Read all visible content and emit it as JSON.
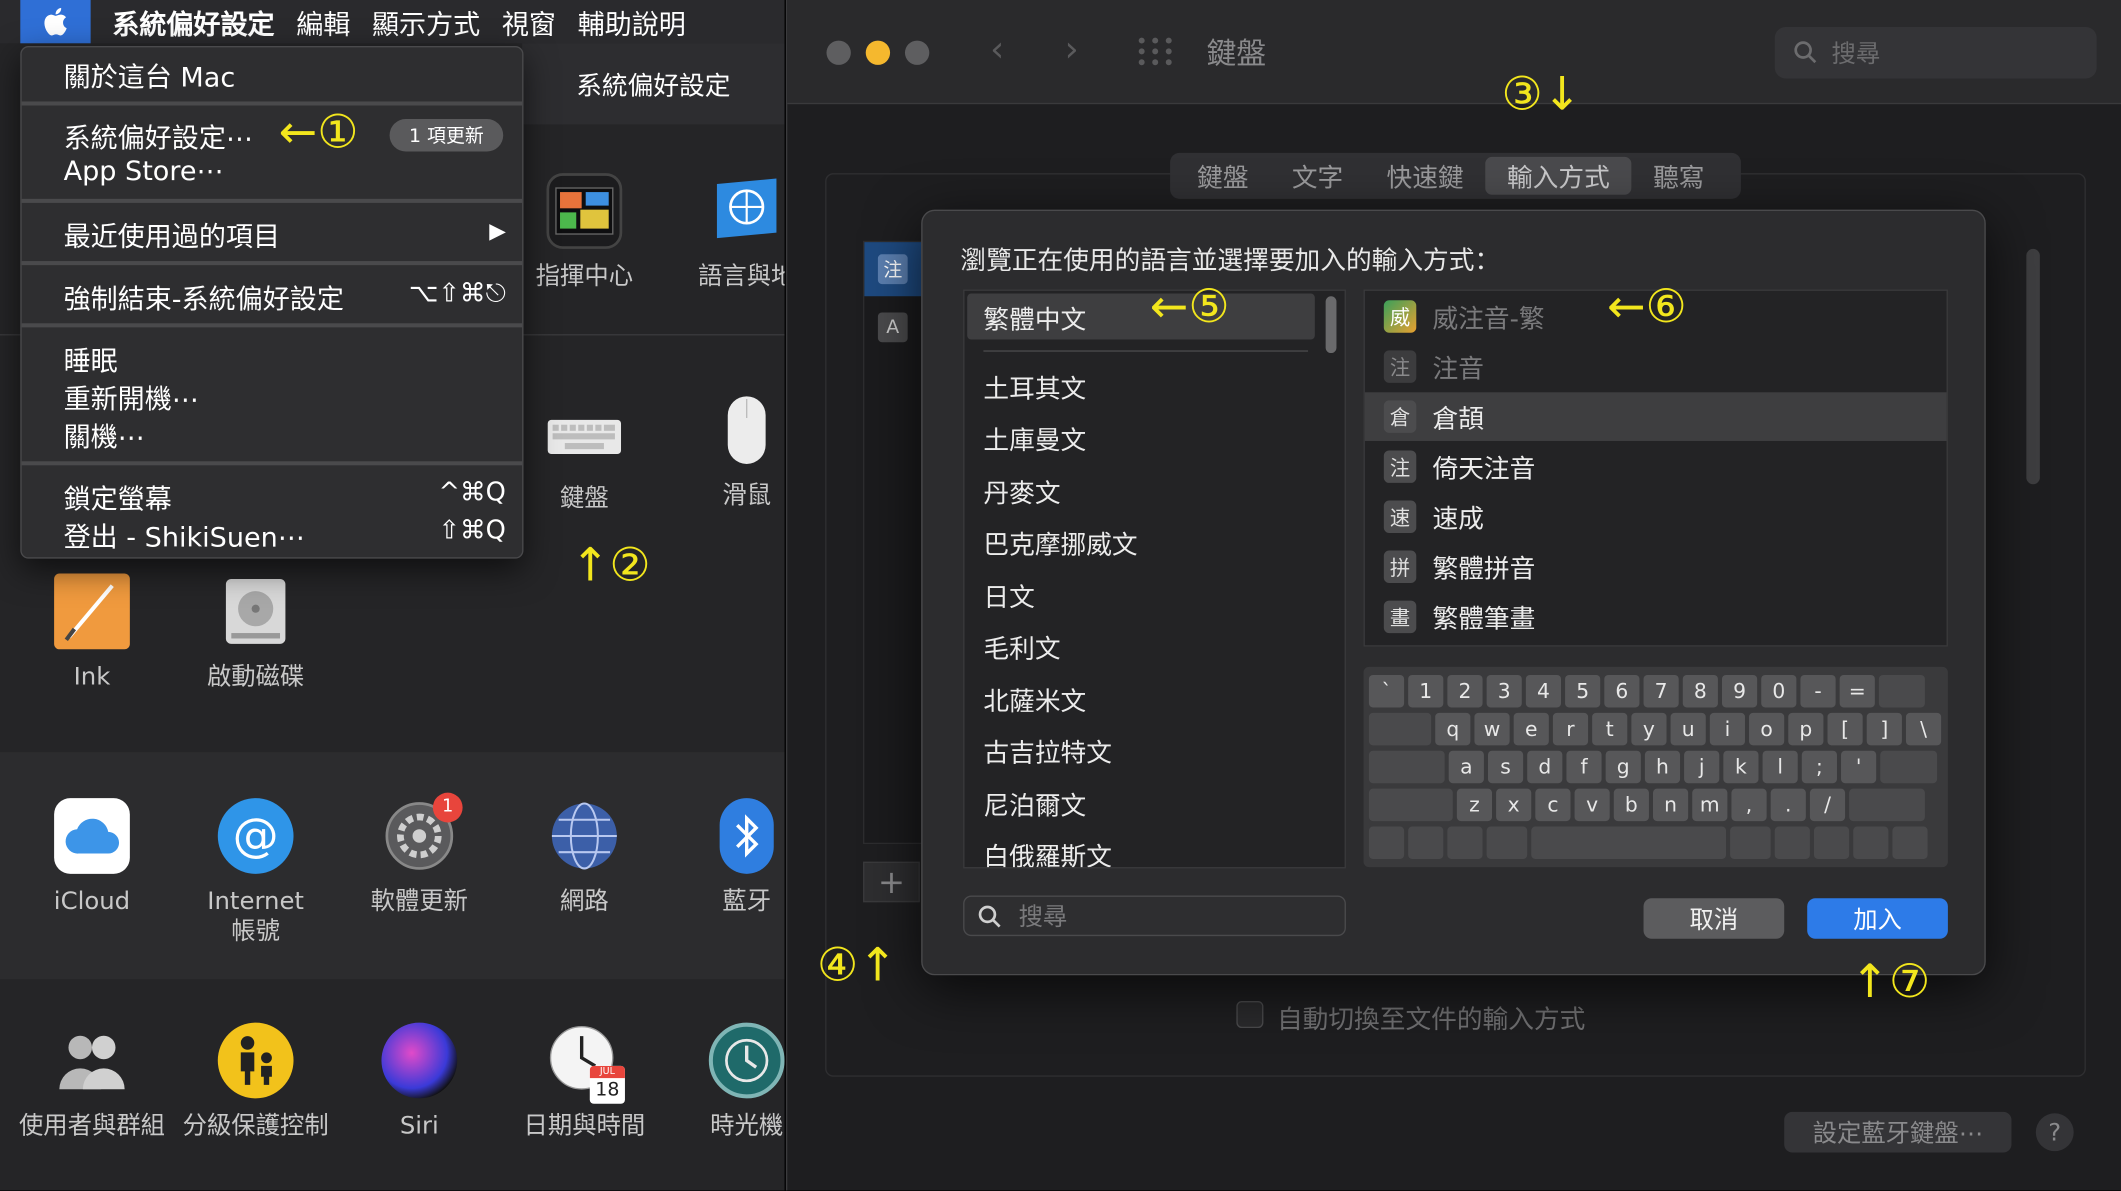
{
  "menubar": {
    "apple": "",
    "items": [
      "系統偏好設定",
      "編輯",
      "顯示方式",
      "視窗",
      "輔助說明"
    ]
  },
  "left_window": {
    "title": "系統偏好設定",
    "row1": [
      {
        "label": "指揮中心",
        "icon": "mission-control-icon"
      },
      {
        "label": "語言與地",
        "icon": "globe-flag-icon"
      }
    ],
    "row2": [
      {
        "label": "鍵盤",
        "icon": "keyboard-icon"
      },
      {
        "label": "滑鼠",
        "icon": "mouse-icon"
      }
    ],
    "row3": [
      {
        "label": "Ink",
        "icon": "ink-icon"
      },
      {
        "label": "啟動磁碟",
        "icon": "disk-icon"
      }
    ],
    "row4": [
      {
        "label": "iCloud",
        "icon": "icloud-icon"
      },
      {
        "label": "Internet\n帳號",
        "icon": "at-icon"
      },
      {
        "label": "軟體更新",
        "icon": "gear-icon",
        "badge": "1"
      },
      {
        "label": "網路",
        "icon": "network-globe-icon"
      },
      {
        "label": "藍牙",
        "icon": "bluetooth-icon"
      }
    ],
    "row5": [
      {
        "label": "使用者與群組",
        "icon": "users-icon"
      },
      {
        "label": "分級保護控制",
        "icon": "parental-icon"
      },
      {
        "label": "Siri",
        "icon": "siri-icon"
      },
      {
        "label": "日期與時間",
        "icon": "clock-calendar-icon",
        "date": "18",
        "month": "JUL"
      },
      {
        "label": "時光機",
        "icon": "time-machine-icon"
      }
    ]
  },
  "apple_menu": {
    "about": "關於這台 Mac",
    "sysprefs": "系統偏好設定⋯",
    "update_badge": "1 項更新",
    "appstore": "App Store⋯",
    "recent": "最近使用過的項目",
    "recent_arrow": "▶",
    "force_quit": "強制結束-系統偏好設定",
    "force_quit_sc": "⌥⇧⌘⎋",
    "sleep": "睡眠",
    "restart": "重新開機⋯",
    "shutdown": "關機⋯",
    "lock": "鎖定螢幕",
    "lock_sc": "^⌘Q",
    "logout": "登出 - ShikiSuen⋯",
    "logout_sc": "⇧⌘Q"
  },
  "keyboard_window": {
    "title": "鍵盤",
    "search_placeholder": "搜尋",
    "tabs": [
      "鍵盤",
      "文字",
      "快速鍵",
      "輸入方式",
      "聽寫"
    ],
    "selected_tab": "輸入方式",
    "source_icons": [
      "注",
      "A"
    ],
    "add_button": "+",
    "auto_switch_label": "自動切換至文件的輸入方式",
    "bt_keyboard_button": "設定藍牙鍵盤⋯",
    "help_button": "?"
  },
  "dialog": {
    "prompt": "瀏覽正在使用的語言並選擇要加入的輸入方式：",
    "languages": [
      "繁體中文",
      "土耳其文",
      "土庫曼文",
      "丹麥文",
      "巴克摩挪威文",
      "日文",
      "毛利文",
      "北薩米文",
      "古吉拉特文",
      "尼泊爾文",
      "白俄羅斯文"
    ],
    "selected_language": "繁體中文",
    "input_methods": [
      {
        "label": "威注音-繁",
        "glyph": "威",
        "state": "disabled"
      },
      {
        "label": "注音",
        "glyph": "注",
        "state": "disabled"
      },
      {
        "label": "倉頡",
        "glyph": "倉",
        "state": "selected"
      },
      {
        "label": "倚天注音",
        "glyph": "注",
        "state": "normal"
      },
      {
        "label": "速成",
        "glyph": "速",
        "state": "normal"
      },
      {
        "label": "繁體拼音",
        "glyph": "拼",
        "state": "normal"
      },
      {
        "label": "繁體筆畫",
        "glyph": "畫",
        "state": "normal"
      }
    ],
    "keyboard_rows": [
      [
        "`",
        "1",
        "2",
        "3",
        "4",
        "5",
        "6",
        "7",
        "8",
        "9",
        "0",
        "-",
        "="
      ],
      [
        "q",
        "w",
        "e",
        "r",
        "t",
        "y",
        "u",
        "i",
        "o",
        "p",
        "[",
        "]",
        "\\"
      ],
      [
        "a",
        "s",
        "d",
        "f",
        "g",
        "h",
        "j",
        "k",
        "l",
        ";",
        "'"
      ],
      [
        "z",
        "x",
        "c",
        "v",
        "b",
        "n",
        "m",
        ",",
        ".",
        "/"
      ]
    ],
    "search_placeholder": "搜尋",
    "cancel": "取消",
    "add": "加入"
  },
  "annotations": {
    "a1": "←①",
    "a2": "↑②",
    "a3": "③↓",
    "a4": "④↑",
    "a5": "←⑤",
    "a6": "←⑥",
    "a7": "↑⑦"
  },
  "colors": {
    "accent": "#2d7be8",
    "annotation": "#f2e61d",
    "badge_red": "#e8453c"
  }
}
